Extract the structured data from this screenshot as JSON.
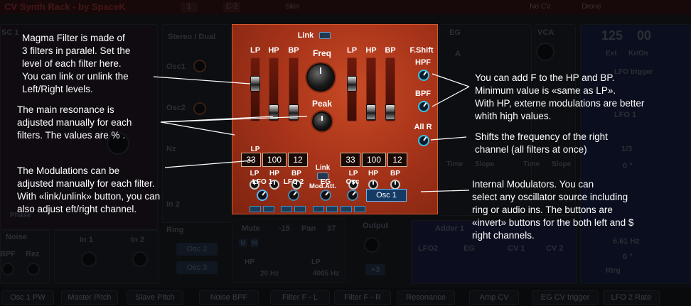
{
  "rack": {
    "title": "CV Synth Rack - by SpaceK",
    "preset_number": "1",
    "note": "C-2",
    "skin_label": "Skin",
    "no_cv_label": "No CV",
    "drone_label": "Drone",
    "sc1_label": "SC 1",
    "stereo_dual_label": "Stereo / Dual",
    "osc1_label": "Osc1",
    "osc2_label": "Osc2",
    "nz_label": "Nz",
    "in2_label": "In 2",
    "ring_label": "Ring",
    "phase_label": "Phase",
    "noise_label": "Noise",
    "bpf_label": "BPF",
    "rez_label": "Rez",
    "in1_label": "In 1",
    "in2_small_label": "In 2",
    "osc2_button": "Osc 2",
    "osc3_button": "Osc 3",
    "mute_label": "Mute",
    "pan_minus": "-15",
    "pan_label": "Pan",
    "pan_plus": "37",
    "output_label": "Output",
    "m_label": "M",
    "hp_label": "HP",
    "hp_value": "20 Hz",
    "lp_label": "LP",
    "lp_value": "4005 Hz",
    "plus3": "+3",
    "adder_label": "Adder 1",
    "lfo2_label": "LFO2",
    "eg_label": "EG",
    "cv1_label": "CV 1",
    "cv2_label": "CV 2",
    "eg_top": "EG",
    "vca_top": "VCA",
    "a_label": "A",
    "time_label": "Time",
    "slope_label": "Slope",
    "time2_label": "Time",
    "slope2_label": "Slope",
    "bpm_value": "125",
    "bpm_value2": "00",
    "ext_label": "Ext",
    "kron_label": "Kr/On",
    "lfo_trigger": "LFO trigger",
    "lfo1_label": "LFO 1",
    "ratio_label": "1/3",
    "deg1": "0 °",
    "freq_value": "6.61 Hz",
    "deg2": "0 °",
    "rtrg_label": "Rtrg",
    "bottom_bar": [
      "Osc 1 PW",
      "Master Pitch",
      "Slave Pitch",
      "Noise BPF",
      "Filter F - L",
      "Filter F - R",
      "Resonance",
      "Amp CV",
      "EG CV trigger",
      "LFO 2 Rate"
    ]
  },
  "filter": {
    "link_label": "Link",
    "freq_label": "Freq",
    "peak_label": "Peak",
    "fshift_label": "F.Shift",
    "hpf_label": "HPF",
    "bpf_label": "BPF",
    "allr_label": "All R",
    "left_sliders": {
      "lp": "LP",
      "hp": "HP",
      "bp": "BP"
    },
    "right_sliders": {
      "lp": "LP",
      "hp": "HP",
      "bp": "BP"
    },
    "left_values": [
      "33",
      "100",
      "12"
    ],
    "right_values": [
      "33",
      "100",
      "12"
    ],
    "res_left": {
      "lp": "LP",
      "hp": "HP",
      "bp": "BP"
    },
    "res_right": {
      "lp": "LP",
      "hp": "HP",
      "bp": "BP"
    },
    "mid_link_label": "Link",
    "mod_att_label": "Mod.Att.",
    "mod": {
      "lfo1": "LFO 1",
      "lfo2": "LFO 2",
      "eg": "EG",
      "osc": "Osc",
      "osc_select": "Osc 1"
    }
  },
  "annotations": {
    "magma": "Magma Filter is made of\n3 filters in paralel. Set the\nlevel of each filter here.\nYou can link or unlink the\nLeft/Right levels.",
    "resonance": "The main resonance is\nadjusted manually for each\nfilters. The values are % .",
    "modulations": "The Modulations can be\nadjusted manually for each filter.\nWith «link/unlink» button, you can\nalso adjust eft/right channel.",
    "fshift": "You can add F to the HP and BP.\nMinimum value is «same as LP».\nWith HP, externe modulations are better\nwhith high values.",
    "allr": "Shifts the frequency of the right\nchannel (all filters at once)",
    "internal": "Internal Modulators. You can\nselect any oscillator source including\nring or audio ins. The buttons are\n«invert» buttons for the both left and $\nright channels."
  }
}
